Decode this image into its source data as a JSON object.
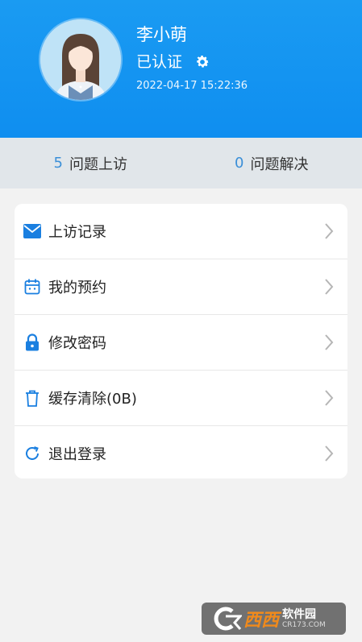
{
  "profile": {
    "name": "李小萌",
    "status": "已认证",
    "timestamp": "2022-04-17 15:22:36"
  },
  "stats": [
    {
      "count": "5",
      "label": "问题上访"
    },
    {
      "count": "0",
      "label": "问题解决"
    }
  ],
  "menu": [
    {
      "icon": "envelope-icon",
      "label": "上访记录"
    },
    {
      "icon": "calendar-icon",
      "label": "我的预约"
    },
    {
      "icon": "lock-icon",
      "label": "修改密码"
    },
    {
      "icon": "trash-icon",
      "label": "缓存清除(0B)"
    },
    {
      "icon": "refresh-icon",
      "label": "退出登录"
    }
  ],
  "watermark": {
    "brand": "西西",
    "name": "软件园",
    "url": "CR173.COM"
  },
  "colors": {
    "header": "#0f8ef0",
    "accent": "#1a7fe0",
    "stat_number": "#3b8fd8"
  }
}
